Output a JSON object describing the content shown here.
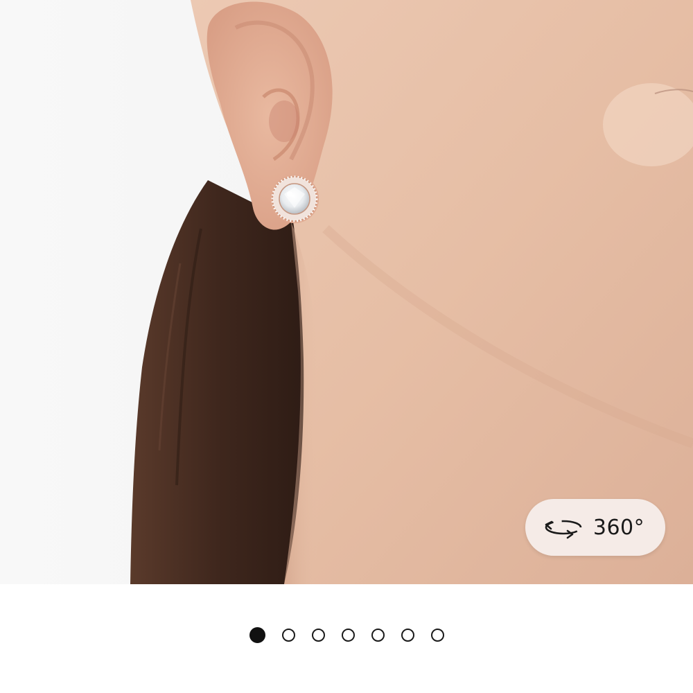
{
  "viewer": {
    "label": "360°",
    "icon": "rotate-360-icon"
  },
  "gallery": {
    "total_images": 7,
    "active_index": 0,
    "dots": [
      {
        "active": true
      },
      {
        "active": false
      },
      {
        "active": false
      },
      {
        "active": false
      },
      {
        "active": false
      },
      {
        "active": false
      },
      {
        "active": false
      }
    ]
  },
  "colors": {
    "background": "#ffffff",
    "skin": "#e8c3ab",
    "hair": "#4a2e22",
    "earring_metal": "#d9a187",
    "button_bg": "#f6f0ee",
    "dot_active": "#111111"
  }
}
